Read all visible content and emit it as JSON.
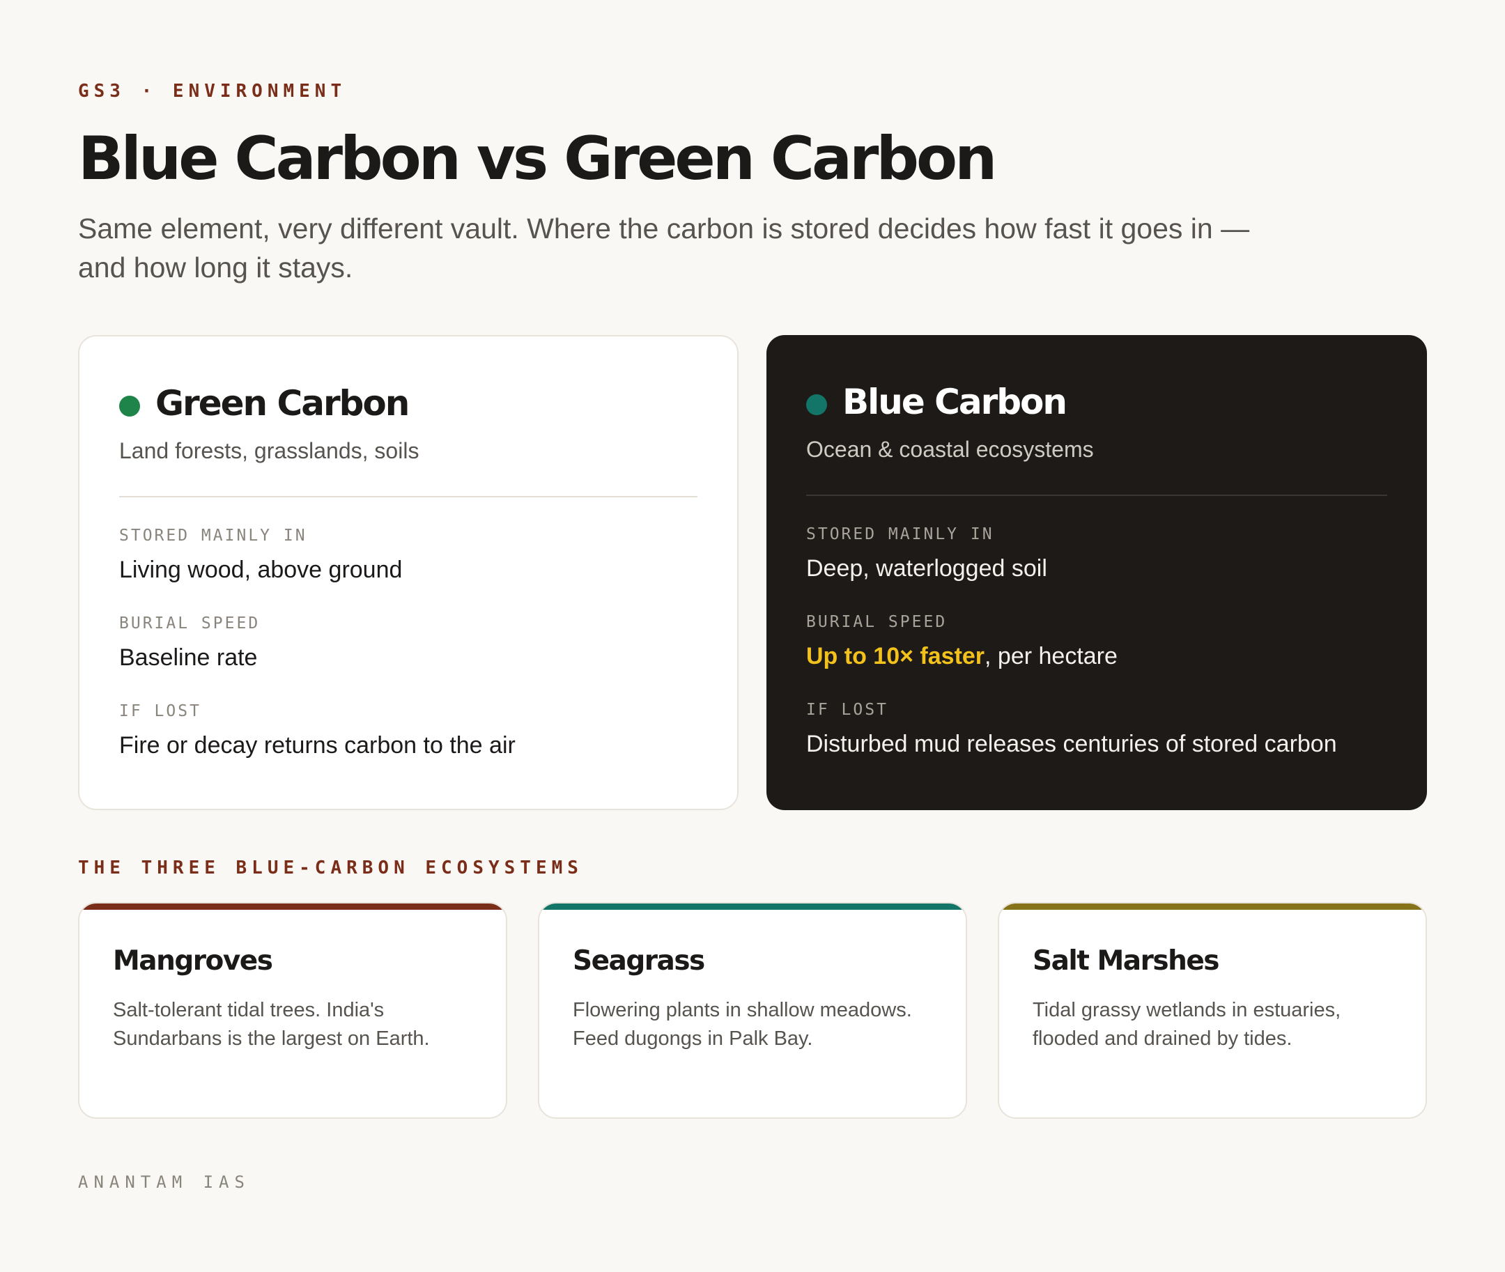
{
  "header": {
    "eyebrow": "GS3 · ENVIRONMENT",
    "title": "Blue Carbon vs Green Carbon",
    "subtitle": "Same element, very different vault. Where the carbon is stored decides how fast it goes in — and how long it stays."
  },
  "green_card": {
    "title": "Green Carbon",
    "dot_color": "#1e8449",
    "subtitle": "Land forests, grasslands, soils",
    "stored_label": "STORED MAINLY IN",
    "stored_value": "Living wood, above ground",
    "speed_label": "BURIAL SPEED",
    "speed_value": "Baseline rate",
    "lost_label": "IF LOST",
    "lost_value": "Fire or decay returns carbon to the air"
  },
  "blue_card": {
    "title": "Blue Carbon",
    "dot_color": "#137567",
    "subtitle": "Ocean & coastal ecosystems",
    "stored_label": "STORED MAINLY IN",
    "stored_value": "Deep, waterlogged soil",
    "speed_label": "BURIAL SPEED",
    "speed_highlight": "Up to 10× faster",
    "speed_rest": ", per hectare",
    "highlight_color": "#f2c11c",
    "lost_label": "IF LOST",
    "lost_value": "Disturbed mud releases centuries of stored carbon"
  },
  "ecosystems": {
    "section_label": "THE THREE BLUE-CARBON ECOSYSTEMS",
    "items": [
      {
        "title": "Mangroves",
        "description": "Salt-tolerant tidal trees. India's Sundarbans is the largest on Earth.",
        "accent": "#7a2e1a"
      },
      {
        "title": "Seagrass",
        "description": "Flowering plants in shallow meadows. Feed dugongs in Palk Bay.",
        "accent": "#137567"
      },
      {
        "title": "Salt Marshes",
        "description": "Tidal grassy wetlands in estuaries, flooded and drained by tides.",
        "accent": "#857219"
      }
    ]
  },
  "footer": {
    "brand": "ANANTAM IAS"
  }
}
